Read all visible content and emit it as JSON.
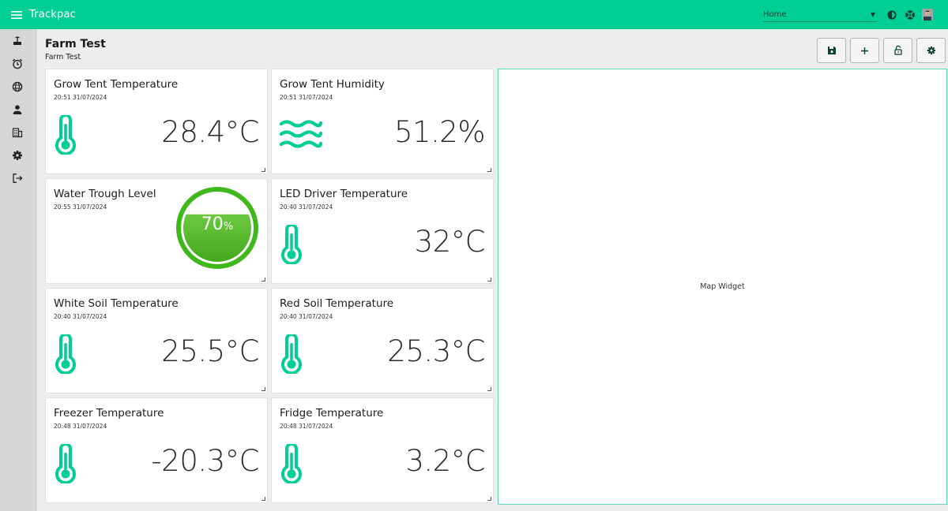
{
  "app": {
    "title": "Trackpac"
  },
  "header": {
    "dashboard_select": "Home"
  },
  "page": {
    "title": "Farm Test",
    "subtitle": "Farm Test"
  },
  "colors": {
    "accent": "#00cf95",
    "gauge_fill": "#4ab520",
    "gauge_ring": "#40b81c"
  },
  "icons": {
    "menu": "menu-icon",
    "theme": "brightness-icon",
    "support": "lifebuoy-icon",
    "profile": "avatar",
    "sidebar": [
      "router-icon",
      "alarm-icon",
      "globe-icon",
      "person-icon",
      "building-icon",
      "gear-icon",
      "logout-icon"
    ],
    "toolbar": [
      "save-icon",
      "plus-icon",
      "unlock-icon",
      "gear-icon"
    ]
  },
  "widgets": [
    {
      "title": "Grow Tent Temperature",
      "timestamp": "20:51 31/07/2024",
      "value": "28.4°C",
      "icon": "thermometer-icon"
    },
    {
      "title": "Grow Tent Humidity",
      "timestamp": "20:51 31/07/2024",
      "value": "51.2%",
      "icon": "waves-icon"
    },
    {
      "title": "Water Trough Level",
      "timestamp": "20:55 31/07/2024",
      "value": "70",
      "unit": "%",
      "level": 0.7,
      "icon": "gauge"
    },
    {
      "title": "LED Driver Temperature",
      "timestamp": "20:40 31/07/2024",
      "value": "32°C",
      "icon": "thermometer-icon"
    },
    {
      "title": "White Soil Temperature",
      "timestamp": "20:40 31/07/2024",
      "value": "25.5°C",
      "icon": "thermometer-icon"
    },
    {
      "title": "Red Soil Temperature",
      "timestamp": "20:40 31/07/2024",
      "value": "25.3°C",
      "icon": "thermometer-icon"
    },
    {
      "title": "Freezer Temperature",
      "timestamp": "20:48 31/07/2024",
      "value": "-20.3°C",
      "icon": "thermometer-icon"
    },
    {
      "title": "Fridge Temperature",
      "timestamp": "20:48 31/07/2024",
      "value": "3.2°C",
      "icon": "thermometer-icon"
    }
  ],
  "map": {
    "label": "Map Widget"
  }
}
